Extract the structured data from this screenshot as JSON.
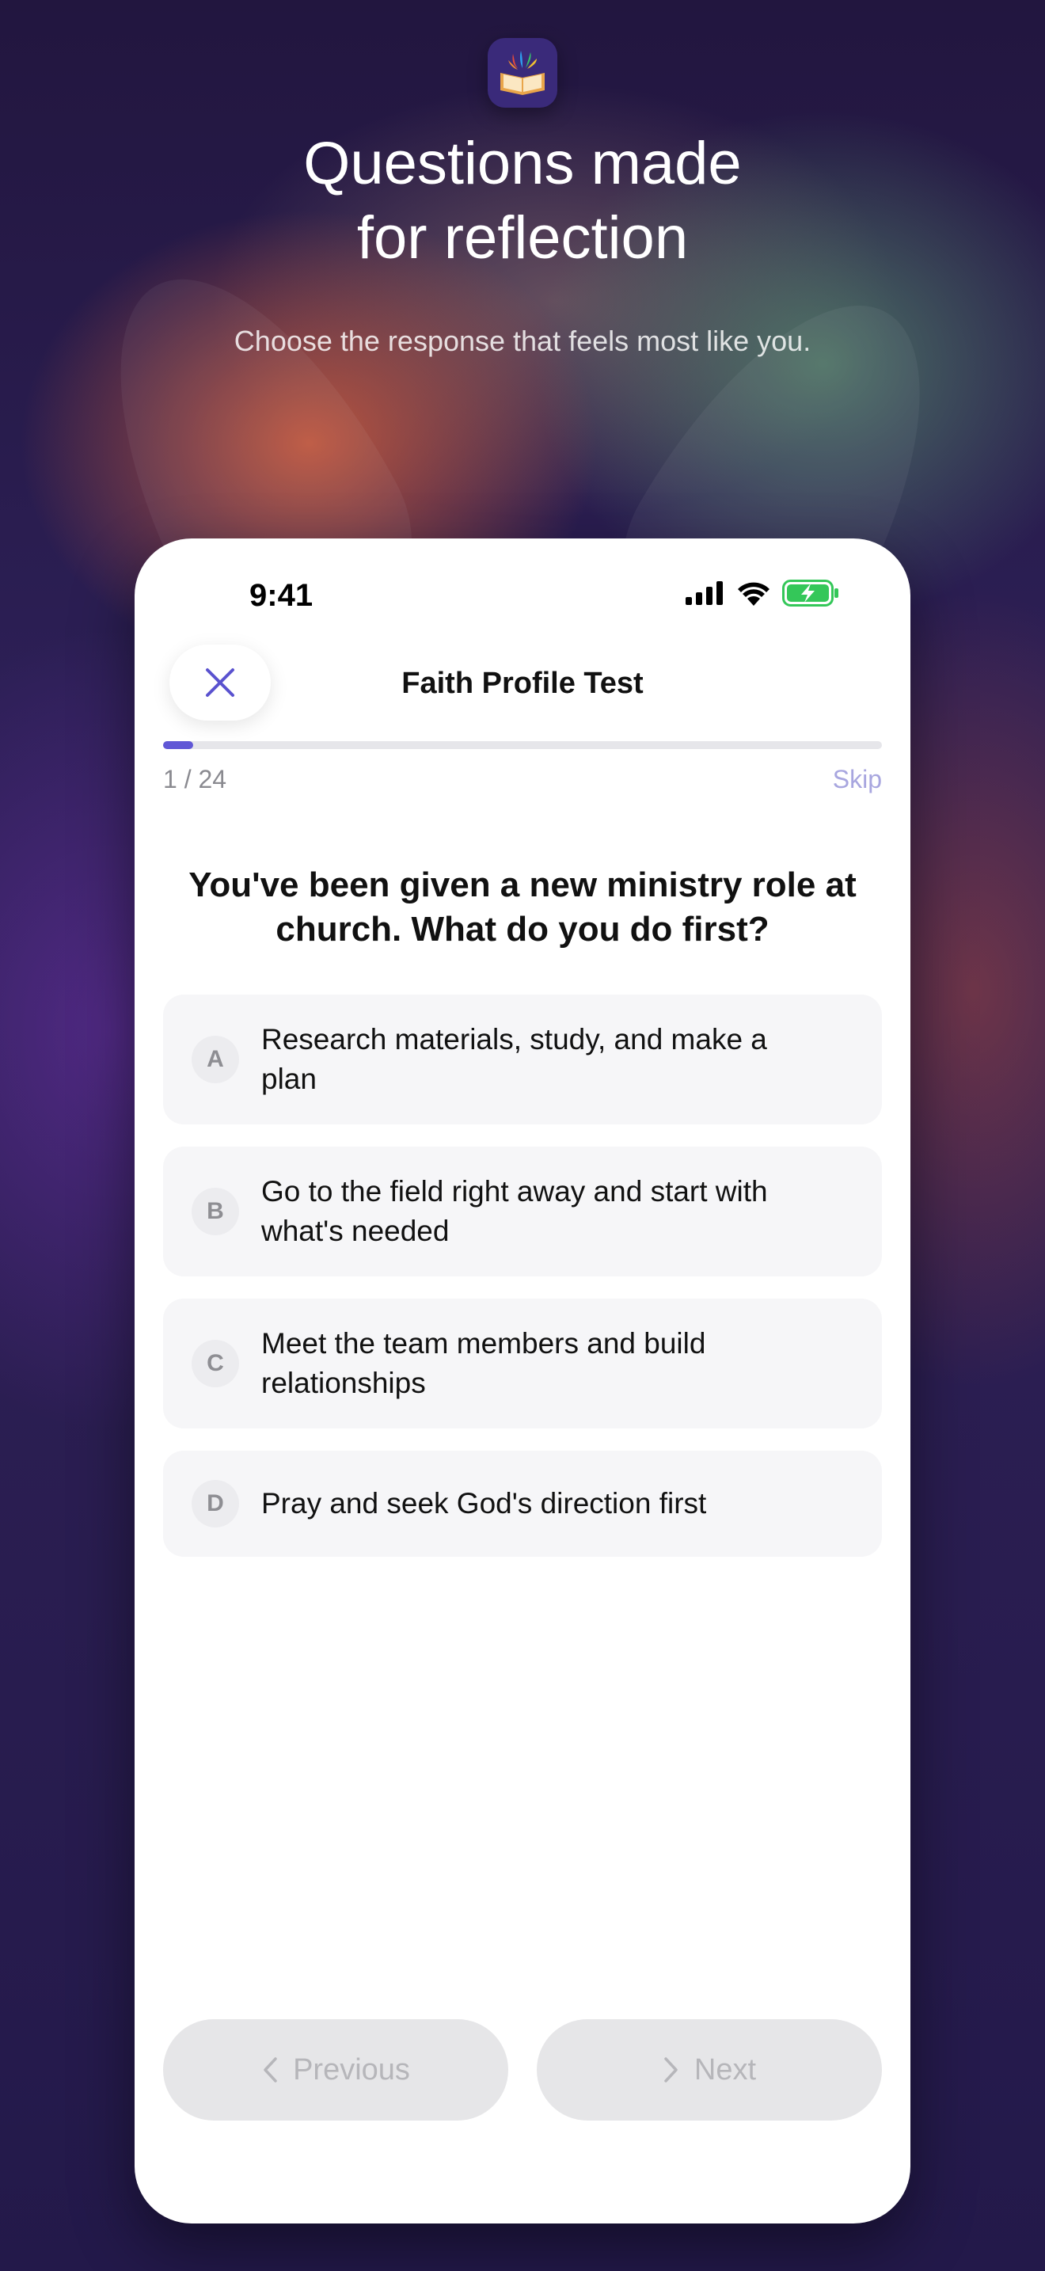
{
  "hero": {
    "title_line1": "Questions made",
    "title_line2": "for reflection",
    "subtitle": "Choose the response that feels most like you."
  },
  "status_bar": {
    "time": "9:41",
    "icons": [
      "cellular-signal-icon",
      "wifi-icon",
      "battery-charging-icon"
    ]
  },
  "header": {
    "title": "Faith Profile Test",
    "close_icon": "close-icon"
  },
  "progress": {
    "current": 1,
    "total": 24,
    "label": "1 / 24",
    "fraction": 0.0417,
    "skip_label": "Skip"
  },
  "question": {
    "text": "You've been given a new ministry role at church. What do you do first?"
  },
  "options": [
    {
      "letter": "A",
      "text": "Research materials, study, and make a plan"
    },
    {
      "letter": "B",
      "text": "Go to the field right away and start with what's needed"
    },
    {
      "letter": "C",
      "text": "Meet the team members and build relationships"
    },
    {
      "letter": "D",
      "text": "Pray and seek God's direction first"
    }
  ],
  "navigation": {
    "previous_label": "Previous",
    "next_label": "Next"
  },
  "colors": {
    "accent": "#6057d6",
    "skip": "#a8a6df",
    "option_bg": "#f6f6f8",
    "disabled_button_bg": "#e6e6e8",
    "battery": "#34c759"
  }
}
